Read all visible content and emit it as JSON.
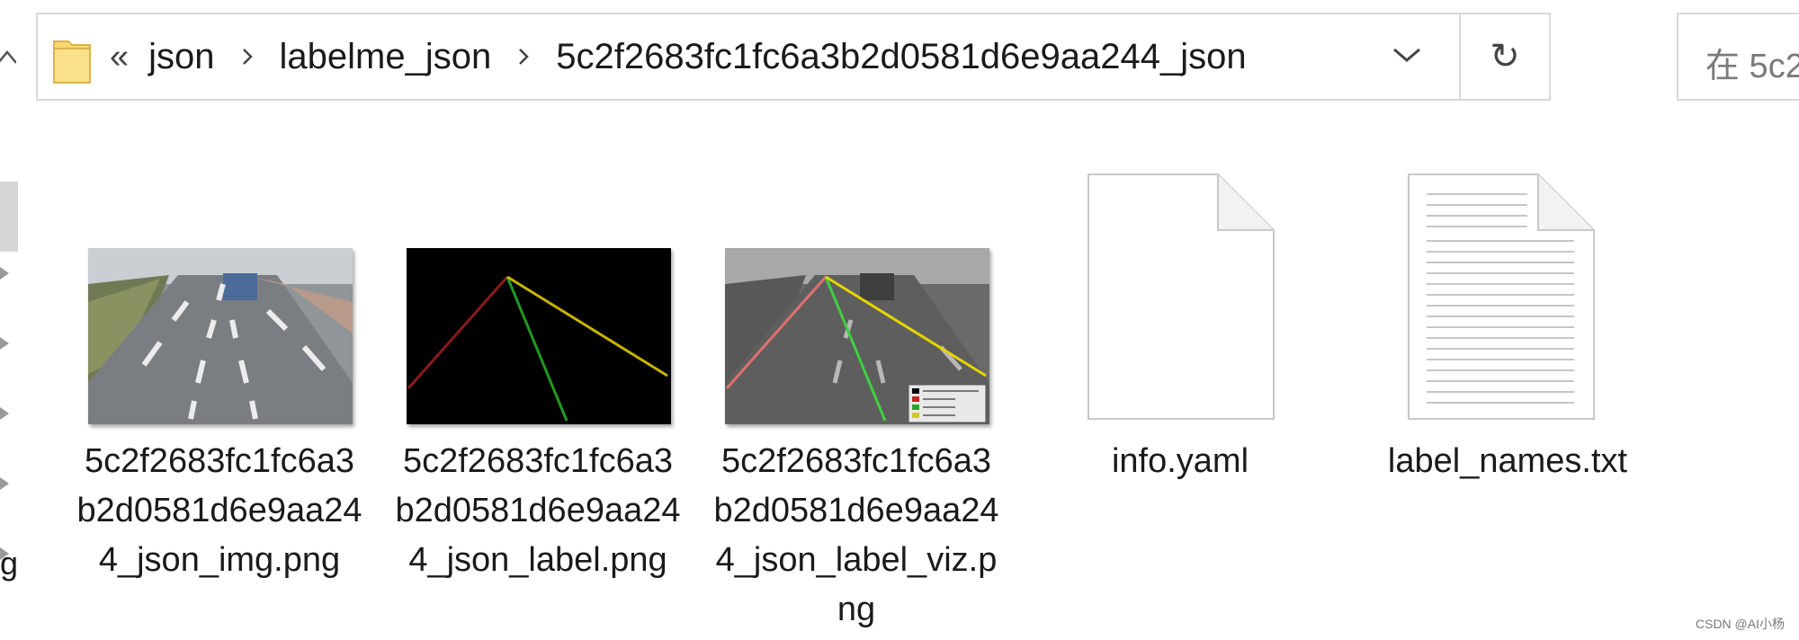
{
  "address_bar": {
    "overflow_glyph": "«",
    "crumbs": [
      "json",
      "labelme_json",
      "5c2f2683fc1fc6a3b2d0581d6e9aa244_json"
    ],
    "refresh_glyph": "↻"
  },
  "search": {
    "placeholder": "在 5c2"
  },
  "left_pane": {
    "partial_label": "g"
  },
  "files": [
    {
      "name": "5c2f2683fc1fc6a3b2d0581d6e9aa244_json_img.png",
      "icon": "road-photo-thumbnail"
    },
    {
      "name": "5c2f2683fc1fc6a3b2d0581d6e9aa244_json_label.png",
      "icon": "label-mask-thumbnail"
    },
    {
      "name": "5c2f2683fc1fc6a3b2d0581d6e9aa244_json_label_viz.png",
      "icon": "label-overlay-thumbnail"
    },
    {
      "name": "info.yaml",
      "icon": "blank-document-icon"
    },
    {
      "name": "label_names.txt",
      "icon": "text-document-icon"
    }
  ],
  "watermark": "CSDN @AI小杨",
  "colors": {
    "folder_yellow": "#f8d775",
    "border": "#d9d9d9",
    "label_red": "#8b1a1a",
    "label_green": "#1f9a1f",
    "label_yellow": "#c8b400"
  }
}
